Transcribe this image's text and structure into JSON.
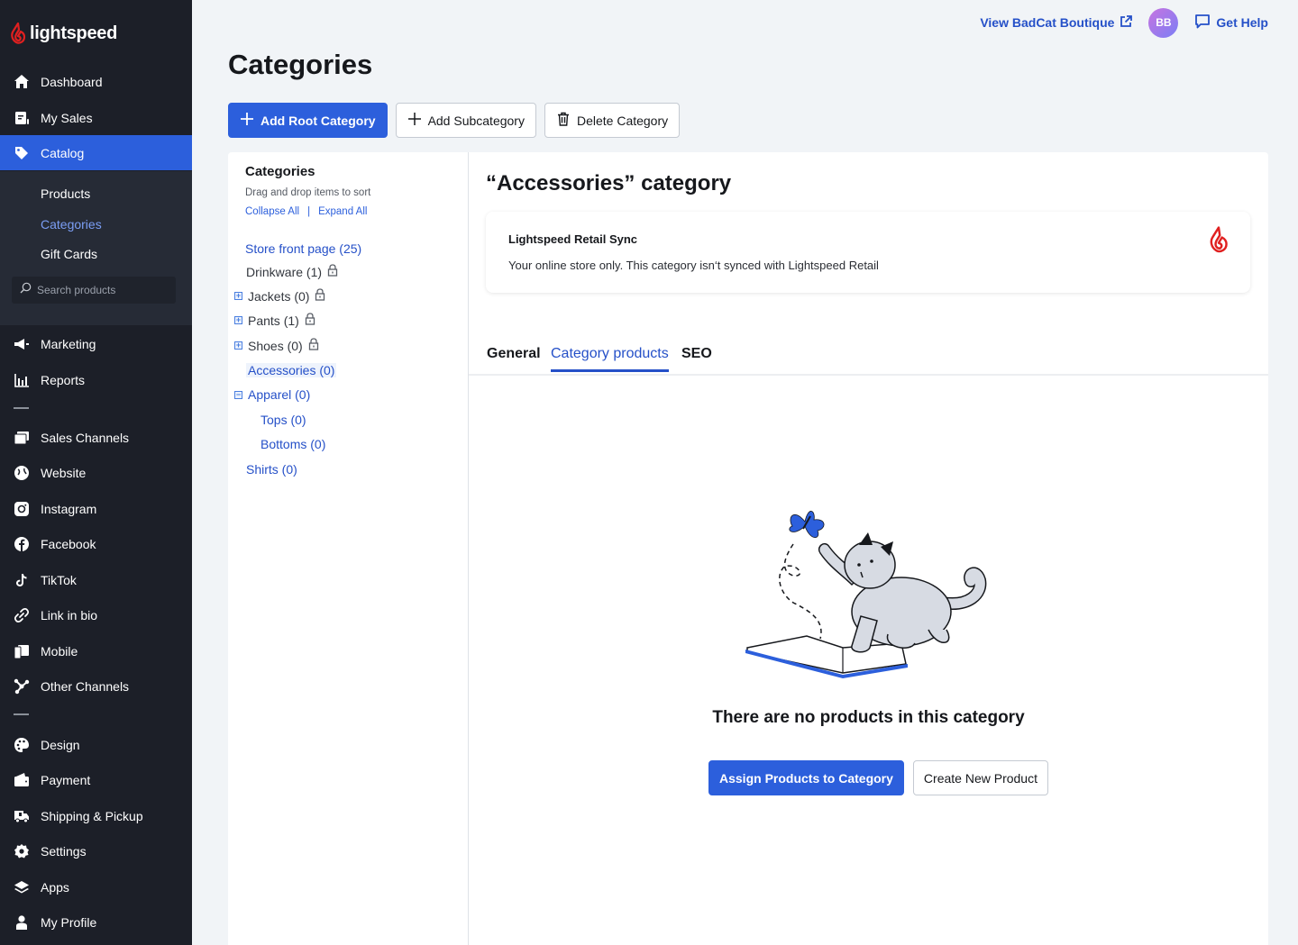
{
  "app": {
    "brand": "lightspeed",
    "brand_color": "#e02020",
    "accent_color": "#2c5fdc"
  },
  "sidebar": {
    "main_items": [
      {
        "label": "Dashboard",
        "icon": "home-icon"
      },
      {
        "label": "My Sales",
        "icon": "receipt-icon"
      },
      {
        "label": "Catalog",
        "icon": "tag-icon",
        "active": true
      }
    ],
    "catalog_submenu": [
      {
        "label": "Products"
      },
      {
        "label": "Categories",
        "active": true
      },
      {
        "label": "Gift Cards"
      }
    ],
    "search_placeholder": "Search products",
    "group1": [
      {
        "label": "Marketing",
        "icon": "megaphone-icon"
      },
      {
        "label": "Reports",
        "icon": "bar-chart-icon"
      }
    ],
    "group2": [
      {
        "label": "Sales Channels",
        "icon": "sales-channels-icon"
      },
      {
        "label": "Website",
        "icon": "globe-icon"
      },
      {
        "label": "Instagram",
        "icon": "instagram-icon"
      },
      {
        "label": "Facebook",
        "icon": "facebook-icon"
      },
      {
        "label": "TikTok",
        "icon": "tiktok-icon"
      },
      {
        "label": "Link in bio",
        "icon": "link-icon"
      },
      {
        "label": "Mobile",
        "icon": "mobile-icon"
      },
      {
        "label": "Other Channels",
        "icon": "network-icon"
      }
    ],
    "group3": [
      {
        "label": "Design",
        "icon": "palette-icon"
      },
      {
        "label": "Payment",
        "icon": "wallet-icon"
      },
      {
        "label": "Shipping & Pickup",
        "icon": "truck-icon"
      },
      {
        "label": "Settings",
        "icon": "gear-icon"
      },
      {
        "label": "Apps",
        "icon": "layers-icon"
      },
      {
        "label": "My Profile",
        "icon": "user-icon"
      }
    ]
  },
  "topbar": {
    "view_store": "View BadCat Boutique",
    "avatar_initials": "BB",
    "help": "Get Help"
  },
  "page": {
    "title": "Categories",
    "toolbar": {
      "add_root": "Add Root Category",
      "add_sub": "Add Subcategory",
      "delete": "Delete Category"
    }
  },
  "categories_panel": {
    "heading": "Categories",
    "help": "Drag and drop items to sort",
    "collapse_all": "Collapse All",
    "separator": "|",
    "expand_all": "Expand All",
    "tree": [
      {
        "label": "Store front page (25)",
        "level": 0,
        "toggle": null,
        "locked": false,
        "style": "link"
      },
      {
        "label": "Drinkware (1)",
        "level": 0,
        "toggle": null,
        "locked": true,
        "style": "dark"
      },
      {
        "label": "Jackets (0)",
        "level": 0,
        "toggle": "+",
        "locked": true,
        "style": "dark"
      },
      {
        "label": "Pants (1)",
        "level": 0,
        "toggle": "+",
        "locked": true,
        "style": "dark"
      },
      {
        "label": "Shoes (0)",
        "level": 0,
        "toggle": "+",
        "locked": true,
        "style": "dark"
      },
      {
        "label": "Accessories (0)",
        "level": 0,
        "toggle": null,
        "locked": false,
        "style": "link",
        "selected": true
      },
      {
        "label": "Apparel (0)",
        "level": 0,
        "toggle": "−",
        "locked": false,
        "style": "link"
      },
      {
        "label": "Tops (0)",
        "level": 1,
        "toggle": null,
        "locked": false,
        "style": "link"
      },
      {
        "label": "Bottoms (0)",
        "level": 1,
        "toggle": null,
        "locked": false,
        "style": "link"
      },
      {
        "label": "Shirts (0)",
        "level": 0,
        "toggle": null,
        "locked": false,
        "style": "link"
      }
    ]
  },
  "detail": {
    "title": "“Accessories” category",
    "sync": {
      "title": "Lightspeed Retail Sync",
      "description": "Your online store only. This category isn‘t synced with Lightspeed Retail"
    },
    "tabs": [
      {
        "label": "General"
      },
      {
        "label": "Category products",
        "active": true
      },
      {
        "label": "SEO"
      }
    ],
    "empty": {
      "title": "There are no products in this category",
      "assign": "Assign Products to Category",
      "create": "Create New Product"
    }
  }
}
